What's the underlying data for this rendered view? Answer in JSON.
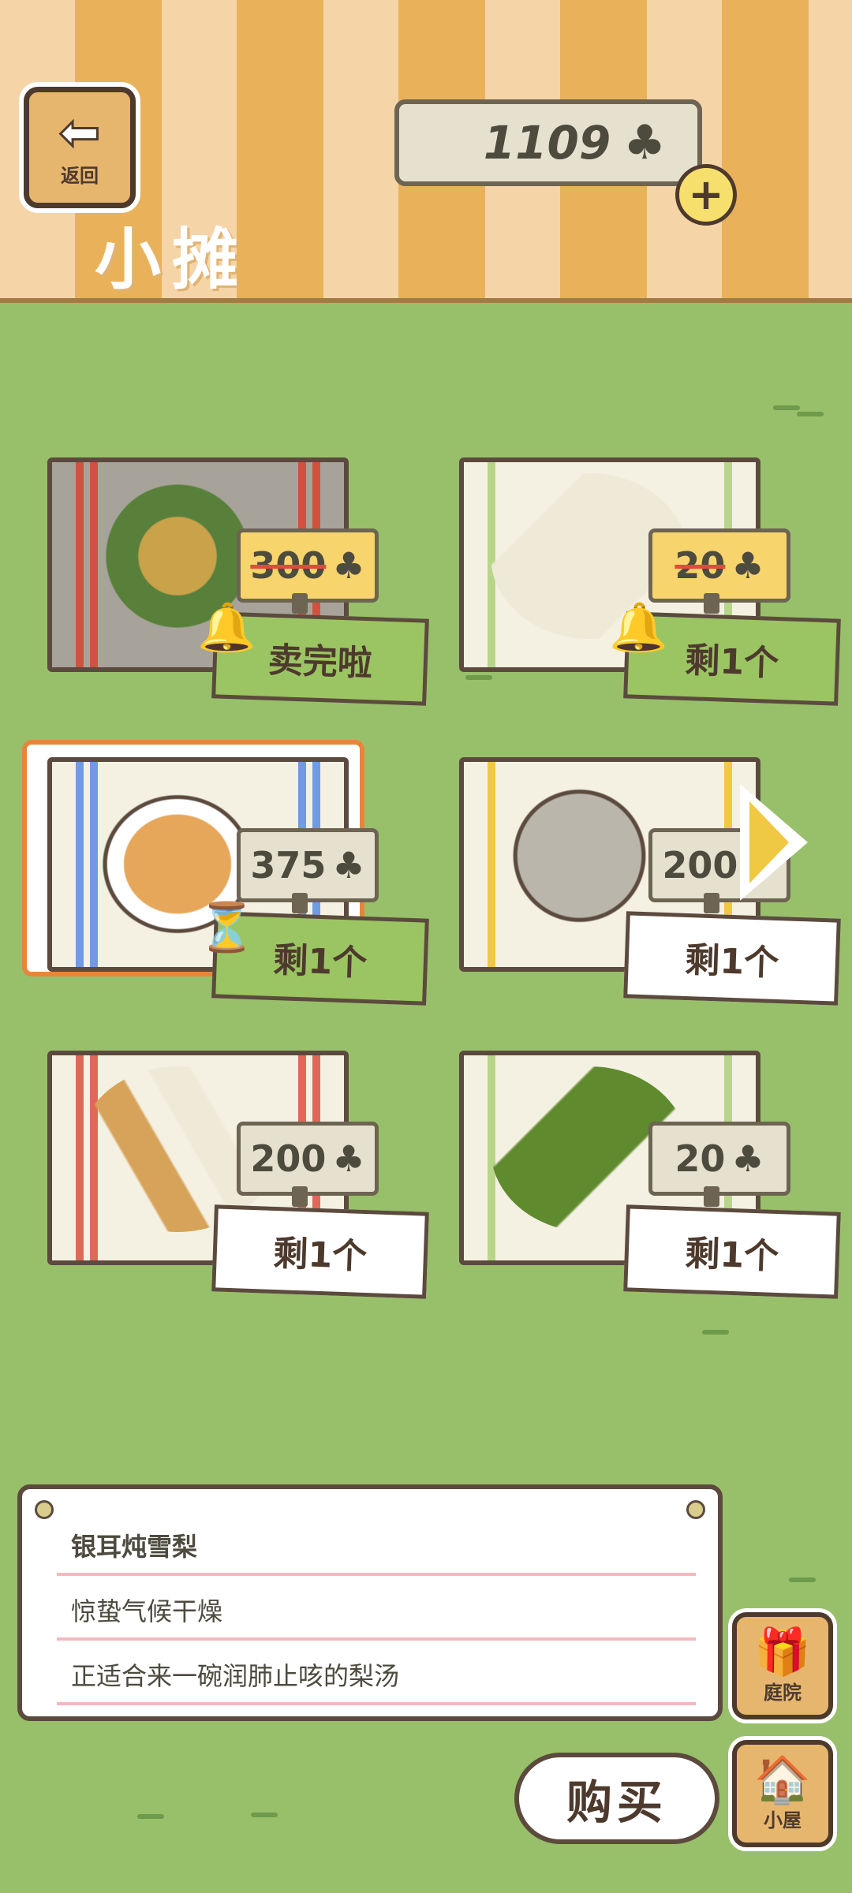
{
  "header": {
    "back_label": "返回",
    "title": "小摊",
    "currency_amount": "1109",
    "currency_icon": "clover-icon"
  },
  "items": [
    {
      "name": "osmanthus",
      "price": "300",
      "price_strike": true,
      "stock": "卖完啦",
      "stock_style": "green"
    },
    {
      "name": "cloth",
      "price": "20",
      "price_strike": true,
      "stock": "剩1个",
      "stock_style": "green"
    },
    {
      "name": "pear-soup",
      "price": "375",
      "price_strike": false,
      "stock": "剩1个",
      "stock_style": "green",
      "selected": true
    },
    {
      "name": "stone",
      "price": "200",
      "price_strike": false,
      "stock": "剩1个",
      "stock_style": "white"
    },
    {
      "name": "wheat",
      "price": "200",
      "price_strike": false,
      "stock": "剩1个",
      "stock_style": "white"
    },
    {
      "name": "bamboo",
      "price": "20",
      "price_strike": false,
      "stock": "剩1个",
      "stock_style": "white"
    }
  ],
  "description": {
    "title": "银耳炖雪梨",
    "line1": "惊蛰气候干燥",
    "line2": "正适合来一碗润肺止咳的梨汤"
  },
  "buttons": {
    "buy": "购买",
    "yard": "庭院",
    "house": "小屋"
  },
  "colors": {
    "grass": "#98c06a",
    "awning_light": "#f5d4a8",
    "awning_dark": "#e9b25a",
    "outline": "#5b4a3d",
    "selected_border": "#e7863a"
  }
}
